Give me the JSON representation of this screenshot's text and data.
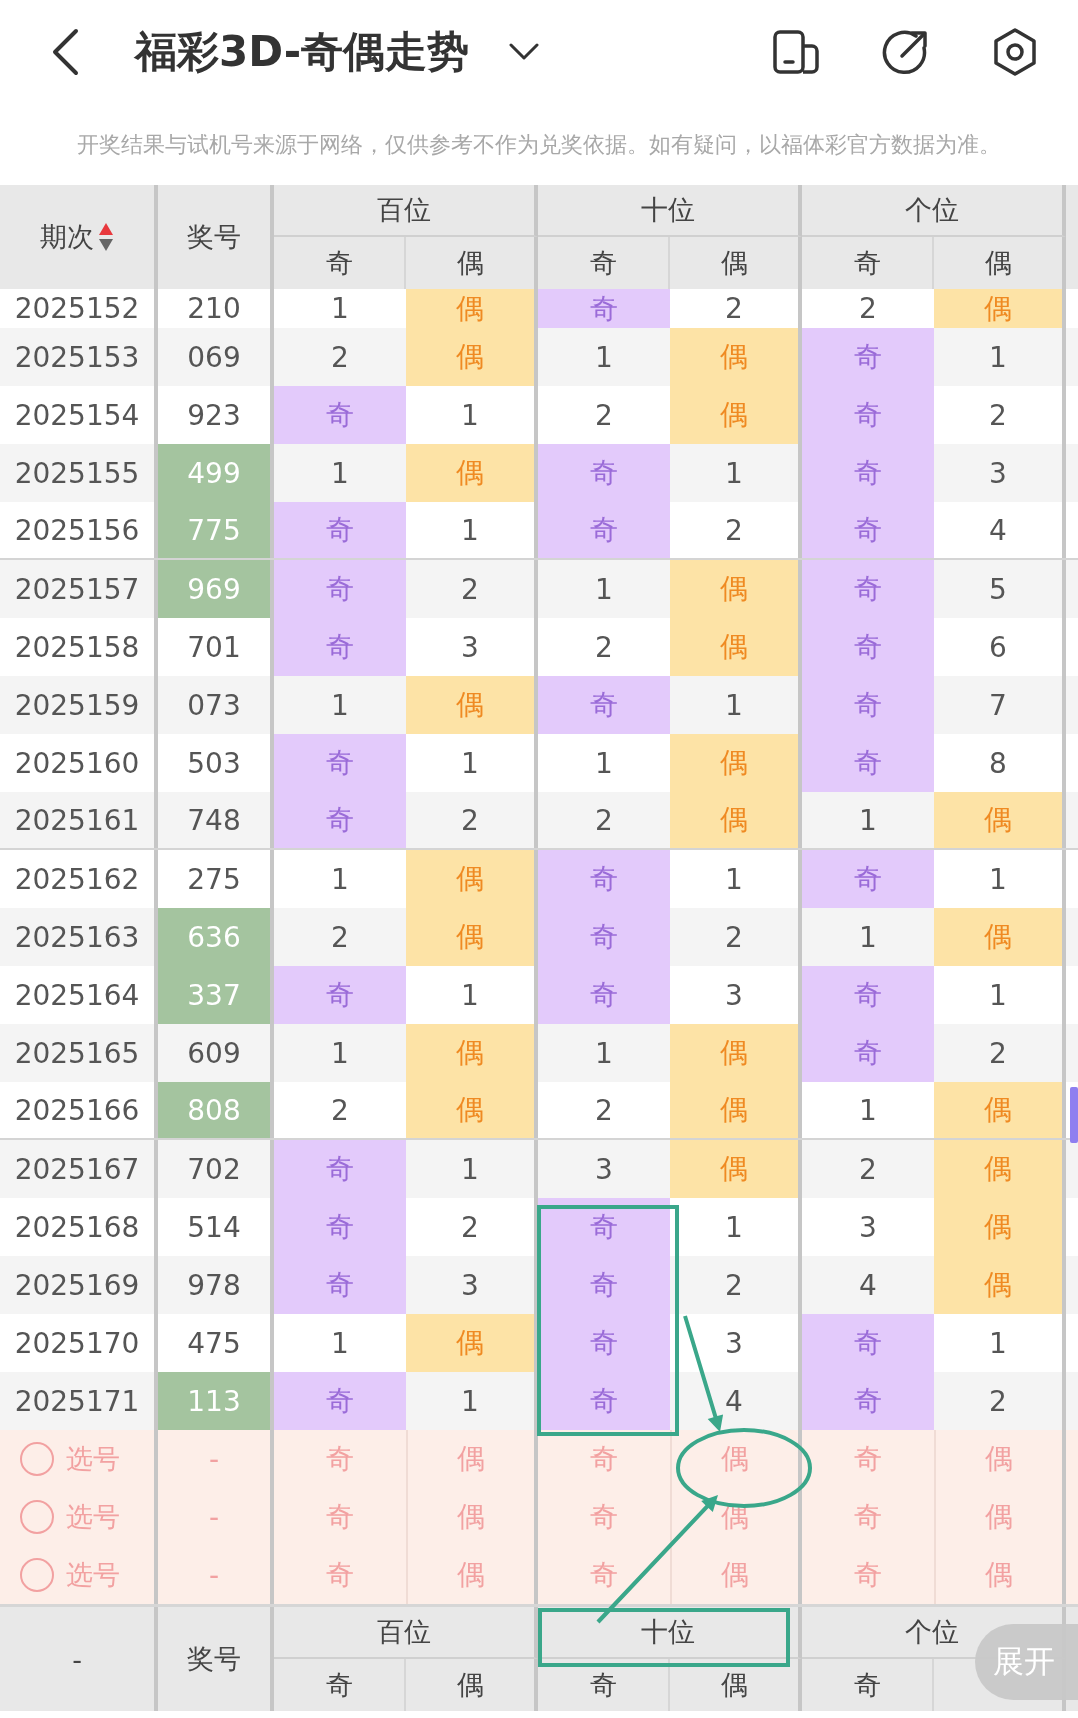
{
  "header": {
    "title": "福彩3D-奇偶走势"
  },
  "notice": "开奖结果与试机号来源于网络，仅供参考不作为兑奖依据。如有疑问，以福体彩官方数据为准。",
  "table": {
    "period_label": "期次",
    "number_label": "奖号",
    "groups": [
      {
        "label": "百位",
        "sub": [
          "奇",
          "偶"
        ]
      },
      {
        "label": "十位",
        "sub": [
          "奇",
          "偶"
        ]
      },
      {
        "label": "个位",
        "sub": [
          "奇",
          "偶"
        ]
      }
    ],
    "rows": [
      {
        "period": "2025152",
        "number": "210",
        "highlighted": false,
        "cells": [
          {
            "text": "1",
            "hit": false
          },
          {
            "text": "偶",
            "hit": true
          },
          {
            "text": "奇",
            "hit": true
          },
          {
            "text": "2",
            "hit": false
          },
          {
            "text": "2",
            "hit": false
          },
          {
            "text": "偶",
            "hit": true
          }
        ]
      },
      {
        "period": "2025153",
        "number": "069",
        "highlighted": false,
        "cells": [
          {
            "text": "2",
            "hit": false
          },
          {
            "text": "偶",
            "hit": true
          },
          {
            "text": "1",
            "hit": false
          },
          {
            "text": "偶",
            "hit": true
          },
          {
            "text": "奇",
            "hit": true
          },
          {
            "text": "1",
            "hit": false
          }
        ]
      },
      {
        "period": "2025154",
        "number": "923",
        "highlighted": false,
        "cells": [
          {
            "text": "奇",
            "hit": true
          },
          {
            "text": "1",
            "hit": false
          },
          {
            "text": "2",
            "hit": false
          },
          {
            "text": "偶",
            "hit": true
          },
          {
            "text": "奇",
            "hit": true
          },
          {
            "text": "2",
            "hit": false
          }
        ]
      },
      {
        "period": "2025155",
        "number": "499",
        "highlighted": true,
        "cells": [
          {
            "text": "1",
            "hit": false
          },
          {
            "text": "偶",
            "hit": true
          },
          {
            "text": "奇",
            "hit": true
          },
          {
            "text": "1",
            "hit": false
          },
          {
            "text": "奇",
            "hit": true
          },
          {
            "text": "3",
            "hit": false
          }
        ]
      },
      {
        "period": "2025156",
        "number": "775",
        "highlighted": true,
        "cells": [
          {
            "text": "奇",
            "hit": true
          },
          {
            "text": "1",
            "hit": false
          },
          {
            "text": "奇",
            "hit": true
          },
          {
            "text": "2",
            "hit": false
          },
          {
            "text": "奇",
            "hit": true
          },
          {
            "text": "4",
            "hit": false
          }
        ]
      },
      {
        "period": "2025157",
        "number": "969",
        "highlighted": true,
        "cells": [
          {
            "text": "奇",
            "hit": true
          },
          {
            "text": "2",
            "hit": false
          },
          {
            "text": "1",
            "hit": false
          },
          {
            "text": "偶",
            "hit": true
          },
          {
            "text": "奇",
            "hit": true
          },
          {
            "text": "5",
            "hit": false
          }
        ]
      },
      {
        "period": "2025158",
        "number": "701",
        "highlighted": false,
        "cells": [
          {
            "text": "奇",
            "hit": true
          },
          {
            "text": "3",
            "hit": false
          },
          {
            "text": "2",
            "hit": false
          },
          {
            "text": "偶",
            "hit": true
          },
          {
            "text": "奇",
            "hit": true
          },
          {
            "text": "6",
            "hit": false
          }
        ]
      },
      {
        "period": "2025159",
        "number": "073",
        "highlighted": false,
        "cells": [
          {
            "text": "1",
            "hit": false
          },
          {
            "text": "偶",
            "hit": true
          },
          {
            "text": "奇",
            "hit": true
          },
          {
            "text": "1",
            "hit": false
          },
          {
            "text": "奇",
            "hit": true
          },
          {
            "text": "7",
            "hit": false
          }
        ]
      },
      {
        "period": "2025160",
        "number": "503",
        "highlighted": false,
        "cells": [
          {
            "text": "奇",
            "hit": true
          },
          {
            "text": "1",
            "hit": false
          },
          {
            "text": "1",
            "hit": false
          },
          {
            "text": "偶",
            "hit": true
          },
          {
            "text": "奇",
            "hit": true
          },
          {
            "text": "8",
            "hit": false
          }
        ]
      },
      {
        "period": "2025161",
        "number": "748",
        "highlighted": false,
        "cells": [
          {
            "text": "奇",
            "hit": true
          },
          {
            "text": "2",
            "hit": false
          },
          {
            "text": "2",
            "hit": false
          },
          {
            "text": "偶",
            "hit": true
          },
          {
            "text": "1",
            "hit": false
          },
          {
            "text": "偶",
            "hit": true
          }
        ]
      },
      {
        "period": "2025162",
        "number": "275",
        "highlighted": false,
        "cells": [
          {
            "text": "1",
            "hit": false
          },
          {
            "text": "偶",
            "hit": true
          },
          {
            "text": "奇",
            "hit": true
          },
          {
            "text": "1",
            "hit": false
          },
          {
            "text": "奇",
            "hit": true
          },
          {
            "text": "1",
            "hit": false
          }
        ]
      },
      {
        "period": "2025163",
        "number": "636",
        "highlighted": true,
        "cells": [
          {
            "text": "2",
            "hit": false
          },
          {
            "text": "偶",
            "hit": true
          },
          {
            "text": "奇",
            "hit": true
          },
          {
            "text": "2",
            "hit": false
          },
          {
            "text": "1",
            "hit": false
          },
          {
            "text": "偶",
            "hit": true
          }
        ]
      },
      {
        "period": "2025164",
        "number": "337",
        "highlighted": true,
        "cells": [
          {
            "text": "奇",
            "hit": true
          },
          {
            "text": "1",
            "hit": false
          },
          {
            "text": "奇",
            "hit": true
          },
          {
            "text": "3",
            "hit": false
          },
          {
            "text": "奇",
            "hit": true
          },
          {
            "text": "1",
            "hit": false
          }
        ]
      },
      {
        "period": "2025165",
        "number": "609",
        "highlighted": false,
        "cells": [
          {
            "text": "1",
            "hit": false
          },
          {
            "text": "偶",
            "hit": true
          },
          {
            "text": "1",
            "hit": false
          },
          {
            "text": "偶",
            "hit": true
          },
          {
            "text": "奇",
            "hit": true
          },
          {
            "text": "2",
            "hit": false
          }
        ]
      },
      {
        "period": "2025166",
        "number": "808",
        "highlighted": true,
        "cells": [
          {
            "text": "2",
            "hit": false
          },
          {
            "text": "偶",
            "hit": true
          },
          {
            "text": "2",
            "hit": false
          },
          {
            "text": "偶",
            "hit": true
          },
          {
            "text": "1",
            "hit": false
          },
          {
            "text": "偶",
            "hit": true
          }
        ]
      },
      {
        "period": "2025167",
        "number": "702",
        "highlighted": false,
        "cells": [
          {
            "text": "奇",
            "hit": true
          },
          {
            "text": "1",
            "hit": false
          },
          {
            "text": "3",
            "hit": false
          },
          {
            "text": "偶",
            "hit": true
          },
          {
            "text": "2",
            "hit": false
          },
          {
            "text": "偶",
            "hit": true
          }
        ]
      },
      {
        "period": "2025168",
        "number": "514",
        "highlighted": false,
        "cells": [
          {
            "text": "奇",
            "hit": true
          },
          {
            "text": "2",
            "hit": false
          },
          {
            "text": "奇",
            "hit": true
          },
          {
            "text": "1",
            "hit": false
          },
          {
            "text": "3",
            "hit": false
          },
          {
            "text": "偶",
            "hit": true
          }
        ]
      },
      {
        "period": "2025169",
        "number": "978",
        "highlighted": false,
        "cells": [
          {
            "text": "奇",
            "hit": true
          },
          {
            "text": "3",
            "hit": false
          },
          {
            "text": "奇",
            "hit": true
          },
          {
            "text": "2",
            "hit": false
          },
          {
            "text": "4",
            "hit": false
          },
          {
            "text": "偶",
            "hit": true
          }
        ]
      },
      {
        "period": "2025170",
        "number": "475",
        "highlighted": false,
        "cells": [
          {
            "text": "1",
            "hit": false
          },
          {
            "text": "偶",
            "hit": true
          },
          {
            "text": "奇",
            "hit": true
          },
          {
            "text": "3",
            "hit": false
          },
          {
            "text": "奇",
            "hit": true
          },
          {
            "text": "1",
            "hit": false
          }
        ]
      },
      {
        "period": "2025171",
        "number": "113",
        "highlighted": true,
        "cells": [
          {
            "text": "奇",
            "hit": true
          },
          {
            "text": "1",
            "hit": false
          },
          {
            "text": "奇",
            "hit": true
          },
          {
            "text": "4",
            "hit": false
          },
          {
            "text": "奇",
            "hit": true
          },
          {
            "text": "2",
            "hit": false
          }
        ]
      }
    ],
    "picker_rows": [
      {
        "label": "选号",
        "checked": false,
        "number": "-",
        "options": [
          "奇",
          "偶",
          "奇",
          "偶",
          "奇",
          "偶"
        ]
      },
      {
        "label": "选号",
        "checked": false,
        "number": "-",
        "options": [
          "奇",
          "偶",
          "奇",
          "偶",
          "奇",
          "偶"
        ]
      },
      {
        "label": "选号",
        "checked": false,
        "number": "-",
        "options": [
          "奇",
          "偶",
          "奇",
          "偶",
          "奇",
          "偶"
        ]
      }
    ]
  },
  "footer": {
    "period": "-",
    "number_label": "奖号",
    "groups": [
      {
        "label": "百位",
        "sub": [
          "奇",
          "偶"
        ]
      },
      {
        "label": "十位",
        "sub": [
          "奇",
          "偶"
        ]
      },
      {
        "label": "个位",
        "sub": [
          "奇"
        ]
      }
    ]
  },
  "expand_button": "展开"
}
